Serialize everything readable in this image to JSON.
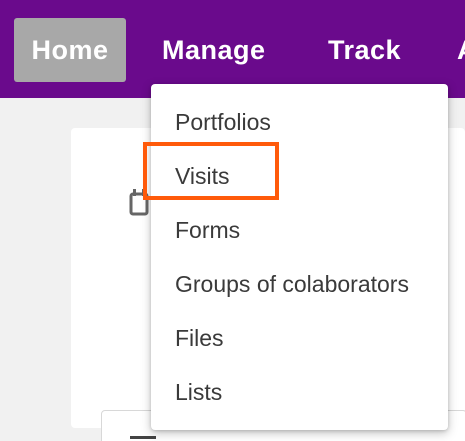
{
  "nav": {
    "items": [
      {
        "label": "Home"
      },
      {
        "label": "Manage"
      },
      {
        "label": "Track"
      },
      {
        "label": "A"
      }
    ]
  },
  "dropdown": {
    "items": [
      {
        "label": "Portfolios"
      },
      {
        "label": "Visits"
      },
      {
        "label": "Forms"
      },
      {
        "label": "Groups of colaborators"
      },
      {
        "label": "Files"
      },
      {
        "label": "Lists"
      }
    ]
  },
  "icons": {
    "background_icon_1": "calendar-icon",
    "background_icon_2": "list-icon"
  },
  "colors": {
    "topbar": "#6a0a8c",
    "active_nav": "#a8a8a8",
    "highlight": "#ff5a0a"
  }
}
